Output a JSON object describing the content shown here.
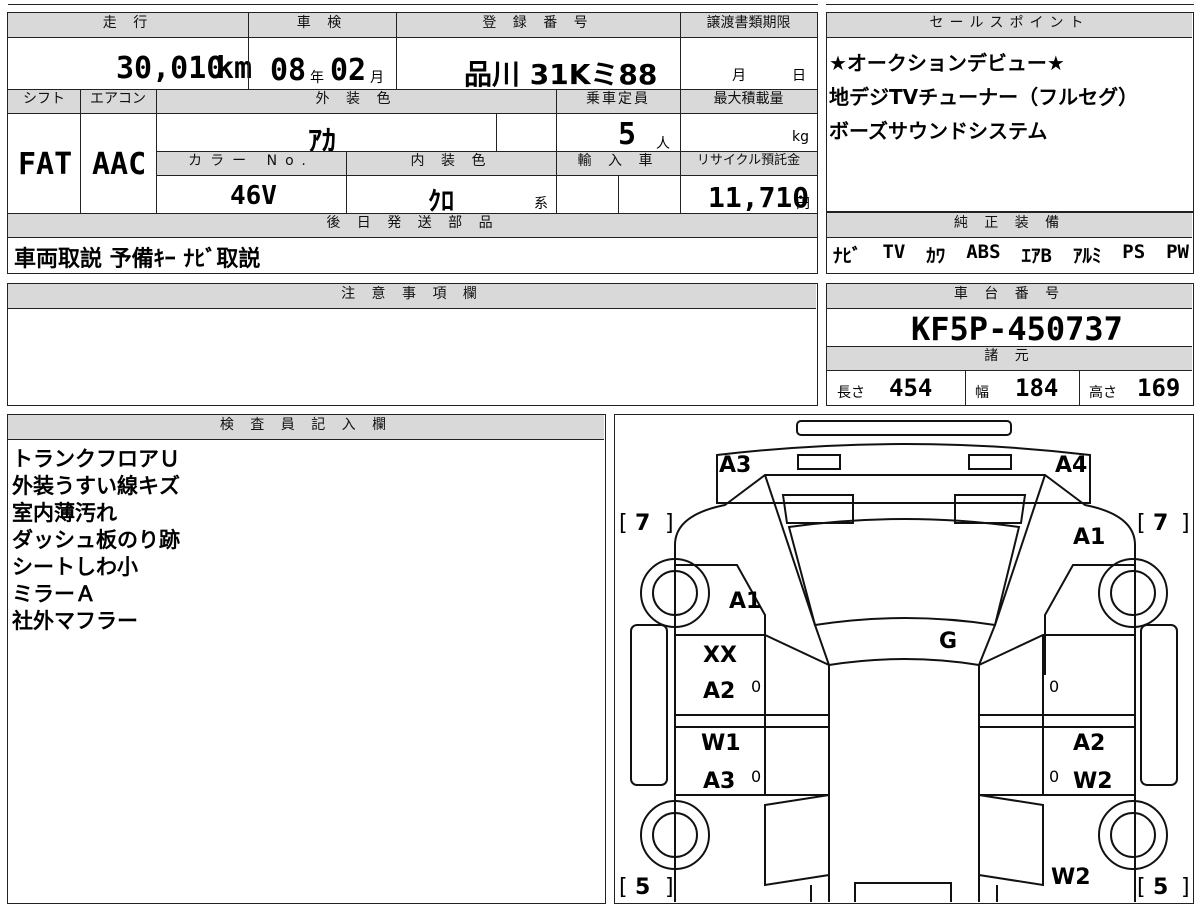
{
  "headers": {
    "mileage": "走 行",
    "inspection": "車 検",
    "registration": "登 録 番 号",
    "transfer_deadline": "譲渡書類期限",
    "sales_points": "セールスポイント",
    "shift": "シフト",
    "aircon": "エアコン",
    "exterior_color": "外 装 色",
    "capacity": "乗車定員",
    "max_load": "最大積載量",
    "color_no": "カラー No.",
    "interior_color": "内 装 色",
    "import": "輸 入 車",
    "recycle_fee": "リサイクル預託金",
    "later_parts": "後 日 発 送 部 品",
    "genuine_equipment": "純 正 装 備",
    "notes": "注 意 事 項 欄",
    "chassis_no": "車 台 番 号",
    "specs": "諸 元",
    "inspector_notes": "検 査 員 記 入 欄"
  },
  "vehicle": {
    "mileage_value": "30,010",
    "mileage_unit": "km",
    "inspection_year": "08",
    "inspection_year_unit": "年",
    "inspection_month": "02",
    "inspection_month_unit": "月",
    "registration_number": "品川 31Kミ88",
    "deadline_month_unit": "月",
    "deadline_day_unit": "日",
    "shift": "FAT",
    "aircon": "AAC",
    "exterior_color": "ｱｶ",
    "capacity": "5",
    "capacity_unit": "人",
    "max_load_unit": "kg",
    "color_no": "46V",
    "interior_color": "ｸﾛ",
    "interior_color_suffix": "系",
    "recycle_fee": "11,710",
    "recycle_fee_unit": "円",
    "chassis_no": "KF5P-450737",
    "length_label": "長さ",
    "length": "454",
    "width_label": "幅",
    "width": "184",
    "height_label": "高さ",
    "height": "169"
  },
  "sales_points": [
    "★オークションデビュー★",
    "地デジTVチューナー（フルセグ）",
    "ボーズサウンドシステム"
  ],
  "later_parts": "車両取説 予備ｷｰ ﾅﾋﾞ取説",
  "genuine_equipment": [
    "ﾅﾋﾞ",
    "TV",
    "ｶﾜ",
    "ABS",
    "ｴｱB",
    "ｱﾙﾐ",
    "PS",
    "PW"
  ],
  "inspector_notes": [
    "トランクフロアＵ",
    "外装うすい線キズ",
    "室内薄汚れ",
    "ダッシュ板のり跡",
    "シートしわ小",
    "ミラーＡ",
    "社外マフラー"
  ],
  "diagram": {
    "labels": {
      "top_left": "A3",
      "top_right": "A4",
      "front_left_fender": "A1",
      "front_right_fender": "A1",
      "roof": "G",
      "left_front_door_1": "XX",
      "left_front_door_2": "A2",
      "left_rear_door_1": "W1",
      "left_rear_door_2": "A3",
      "right_rear_door_1": "A2",
      "right_rear_door_2": "W2",
      "rear_right": "W2"
    },
    "tire_front_left": "7",
    "tire_front_right": "7",
    "tire_rear_left": "5",
    "tire_rear_right": "5",
    "bracket_open": "[",
    "bracket_close": "]",
    "door_marks": [
      "0",
      "0",
      "0",
      "0"
    ]
  }
}
